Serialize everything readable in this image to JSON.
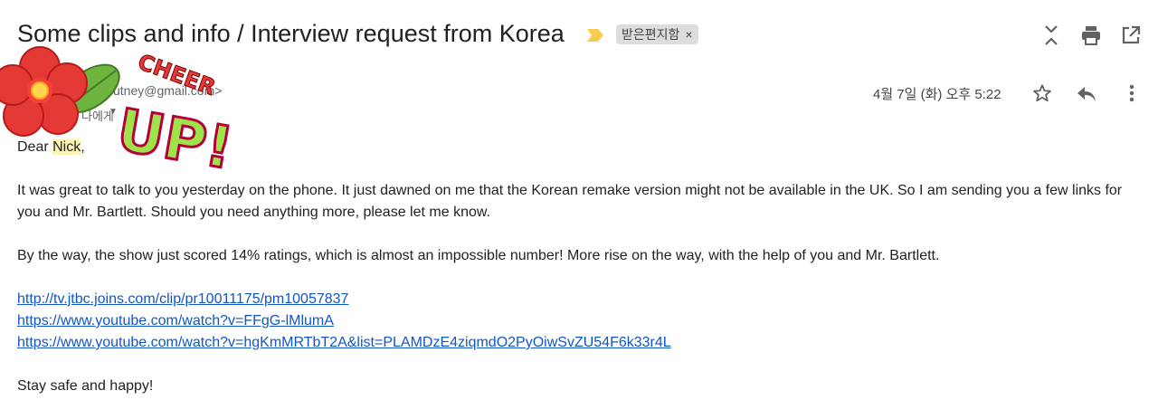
{
  "subject": "Some clips and info / Interview request from Korea",
  "label": {
    "text": "받은편지함",
    "close": "×"
  },
  "toolbar": {
    "icons": [
      "collapse-icon",
      "print-icon",
      "open-new-window-icon"
    ]
  },
  "sender": {
    "address_fragment": "sutney@gmail.com>",
    "to_me": "나에게"
  },
  "date": "4월 7일 (화) 오후 5:22",
  "message": {
    "greeting_prefix": "Dear ",
    "greeting_name": "Nick",
    "greeting_suffix": ",",
    "para1": "It was great to talk to you yesterday on the phone. It just dawned on me that the Korean remake version might not be available in the UK. So I am sending you a few links for you and Mr. Bartlett. Should you need anything more, please let me know.",
    "para2": "By the way, the show just scored 14% ratings, which is almost an impossible number! More rise on the way, with the help of you and Mr. Bartlett.",
    "links": [
      "http://tv.jtbc.joins.com/clip/pr10011175/pm10057837",
      "https://www.youtube.com/watch?v=FFgG-lMlumA",
      "https://www.youtube.com/watch?v=hgKmMRTbT2A&list=PLAMDzE4ziqmdO2PyOiwSvZU54F6k33r4L"
    ],
    "closing": "Stay safe and happy!"
  },
  "sticker": {
    "text_top": "CHEER",
    "text_bottom": "UP!"
  },
  "colors": {
    "link": "#1155cc",
    "importance": "#f7cb4d",
    "highlight": "#fbf6b3"
  }
}
